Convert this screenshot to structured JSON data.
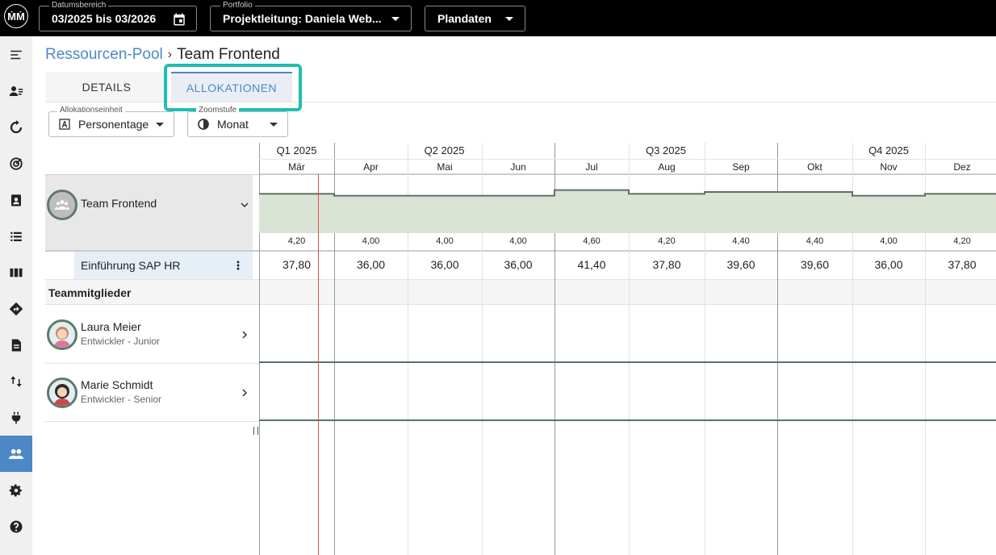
{
  "app": {
    "logo_text": "ṀṀ"
  },
  "topbar": {
    "date_range": {
      "legend": "Datumsbereich",
      "value": "03/2025 bis 03/2026"
    },
    "portfolio": {
      "legend": "Portfolio",
      "value": "Projektleitung: Daniela Web..."
    },
    "dataset": {
      "value": "Plandaten"
    }
  },
  "sidebar": {
    "items": [
      {
        "icon": "menu-collapse-icon"
      },
      {
        "icon": "person-list-icon"
      },
      {
        "icon": "cycle-icon"
      },
      {
        "icon": "target-icon"
      },
      {
        "icon": "assignment-icon"
      },
      {
        "icon": "list-icon"
      },
      {
        "icon": "columns-icon"
      },
      {
        "icon": "direction-icon"
      },
      {
        "icon": "document-icon"
      },
      {
        "icon": "sort-arrows-icon"
      },
      {
        "icon": "plug-icon"
      },
      {
        "icon": "team-icon",
        "active": true
      },
      {
        "icon": "gear-icon"
      },
      {
        "icon": "help-icon"
      }
    ]
  },
  "breadcrumb": {
    "parent": "Ressourcen-Pool",
    "separator": "›",
    "current": "Team Frontend"
  },
  "tabs": {
    "details": "DETAILS",
    "allocations": "ALLOKATIONEN"
  },
  "filters": {
    "unit": {
      "legend": "Allokationseinheit",
      "value": "Personentage"
    },
    "zoom": {
      "legend": "Zoomstufe",
      "value": "Monat"
    }
  },
  "timeline": {
    "quarters": [
      "Q1 2025",
      "Q2 2025",
      "Q3 2025",
      "Q4 2025"
    ],
    "months": [
      "Mär",
      "Apr",
      "Mai",
      "Jun",
      "Jul",
      "Aug",
      "Sep",
      "Okt",
      "Nov",
      "Dez"
    ]
  },
  "team": {
    "name": "Team Frontend",
    "monthly_capacity": [
      "4,20",
      "4,00",
      "4,00",
      "4,00",
      "4,60",
      "4,20",
      "4,40",
      "4,40",
      "4,00",
      "4,20"
    ],
    "project": {
      "name": "Einführung SAP HR",
      "values": [
        "37,80",
        "36,00",
        "36,00",
        "36,00",
        "41,40",
        "37,80",
        "39,60",
        "39,60",
        "36,00",
        "37,80"
      ]
    }
  },
  "members_section": {
    "title": "Teammitglieder"
  },
  "members": [
    {
      "name": "Laura Meier",
      "role": "Entwickler - Junior"
    },
    {
      "name": "Marie Schmidt",
      "role": "Entwickler - Senior"
    }
  ],
  "colors": {
    "accent": "#4d87c7",
    "highlight": "#1ebfb0",
    "capacity_fill": "#d9e4d4",
    "capacity_line": "#5a7264",
    "today_line": "#d9534f"
  }
}
